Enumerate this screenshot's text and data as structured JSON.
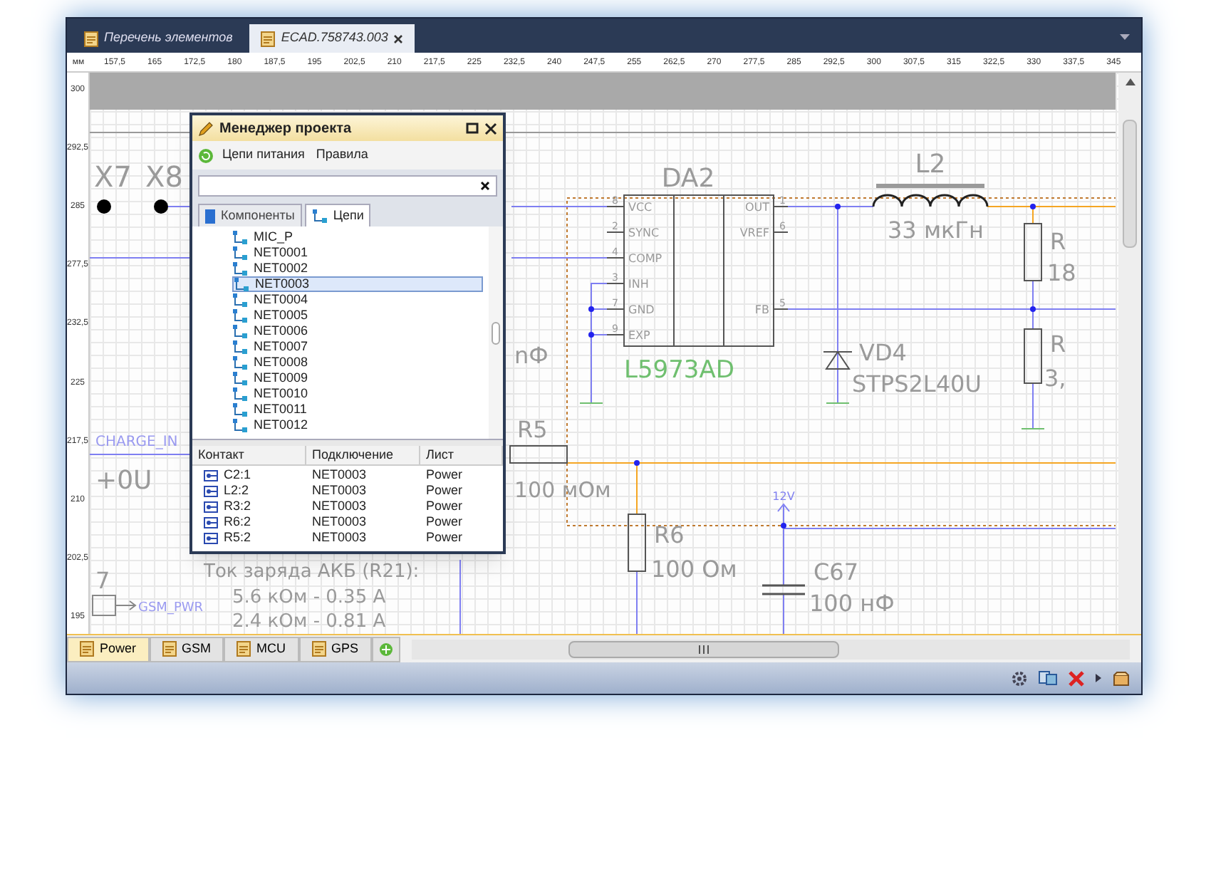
{
  "window": {
    "tabs": [
      {
        "label": "Перечень элементов",
        "selected": false
      },
      {
        "label": "ECAD.758743.003",
        "selected": true
      }
    ]
  },
  "ruler": {
    "unit": "мм",
    "x_labels": [
      "157,5",
      "165",
      "172,5",
      "180",
      "187,5",
      "195",
      "202,5",
      "210",
      "217,5",
      "225",
      "232,5",
      "240",
      "247,5",
      "255",
      "262,5",
      "270",
      "277,5",
      "285",
      "292,5",
      "300",
      "307,5",
      "315",
      "322,5",
      "330",
      "337,5",
      "345"
    ],
    "y_labels": [
      "300",
      "292,5",
      "285",
      "277,5",
      "232,5",
      "225",
      "217,5",
      "210",
      "202,5",
      "195"
    ]
  },
  "schematic": {
    "connectors": [
      {
        "ref": "X7"
      },
      {
        "ref": "X8"
      }
    ],
    "da2": {
      "ref": "DA2",
      "part": "L5973AD",
      "pins_left": [
        {
          "num": "8",
          "name": "VCC"
        },
        {
          "num": "2",
          "name": "SYNC"
        },
        {
          "num": "4",
          "name": "COMP"
        },
        {
          "num": "3",
          "name": "INH"
        },
        {
          "num": "7",
          "name": "GND"
        },
        {
          "num": "9",
          "name": "EXP"
        }
      ],
      "pins_right": [
        {
          "num": "1",
          "name": "OUT"
        },
        {
          "num": "6",
          "name": "VREF"
        },
        {
          "num": "5",
          "name": "FB"
        }
      ]
    },
    "l2": {
      "ref": "L2",
      "value": "33 мкГн"
    },
    "vd4": {
      "ref": "VD4",
      "part": "STPS2L40U"
    },
    "r_top": {
      "ref": "R",
      "value": "18"
    },
    "r_bottom": {
      "ref": "R",
      "value": "3,"
    },
    "cap_fragment": "nФ",
    "r5": {
      "ref": "R5",
      "value": "100 мОм"
    },
    "r6": {
      "ref": "R6",
      "value": "100 Ом"
    },
    "power_port": "12V",
    "c67": {
      "ref": "C67",
      "value": "100 нФ"
    },
    "charge_net": "CHARGE_IN",
    "voltage_fragment": "+0U",
    "pin_label": "7",
    "gsm_net": "GSM_PWR",
    "note": {
      "title": "Ток заряда АКБ (R21):",
      "lines": [
        "5.6 кОм - 0.35 А",
        "2.4 кОм - 0.81 А"
      ]
    }
  },
  "project_manager": {
    "title": "Менеджер проекта",
    "toolbar": [
      "Цепи питания",
      "Правила"
    ],
    "tabs": [
      {
        "label": "Компоненты",
        "selected": false
      },
      {
        "label": "Цепи",
        "selected": true
      }
    ],
    "nets": [
      {
        "name": "MIC_P",
        "selected": false
      },
      {
        "name": "NET0001",
        "selected": false
      },
      {
        "name": "NET0002",
        "selected": false
      },
      {
        "name": "NET0003",
        "selected": true
      },
      {
        "name": "NET0004",
        "selected": false
      },
      {
        "name": "NET0005",
        "selected": false
      },
      {
        "name": "NET0006",
        "selected": false
      },
      {
        "name": "NET0007",
        "selected": false
      },
      {
        "name": "NET0008",
        "selected": false
      },
      {
        "name": "NET0009",
        "selected": false
      },
      {
        "name": "NET0010",
        "selected": false
      },
      {
        "name": "NET0011",
        "selected": false
      },
      {
        "name": "NET0012",
        "selected": false
      }
    ],
    "table": {
      "columns": [
        "Контакт",
        "Подключение",
        "Лист"
      ],
      "rows": [
        [
          "C2:1",
          "NET0003",
          "Power"
        ],
        [
          "L2:2",
          "NET0003",
          "Power"
        ],
        [
          "R3:2",
          "NET0003",
          "Power"
        ],
        [
          "R6:2",
          "NET0003",
          "Power"
        ],
        [
          "R5:2",
          "NET0003",
          "Power"
        ]
      ]
    }
  },
  "sheet_tabs": [
    {
      "label": "Power",
      "selected": true
    },
    {
      "label": "GSM",
      "selected": false
    },
    {
      "label": "MCU",
      "selected": false
    },
    {
      "label": "GPS",
      "selected": false
    }
  ]
}
